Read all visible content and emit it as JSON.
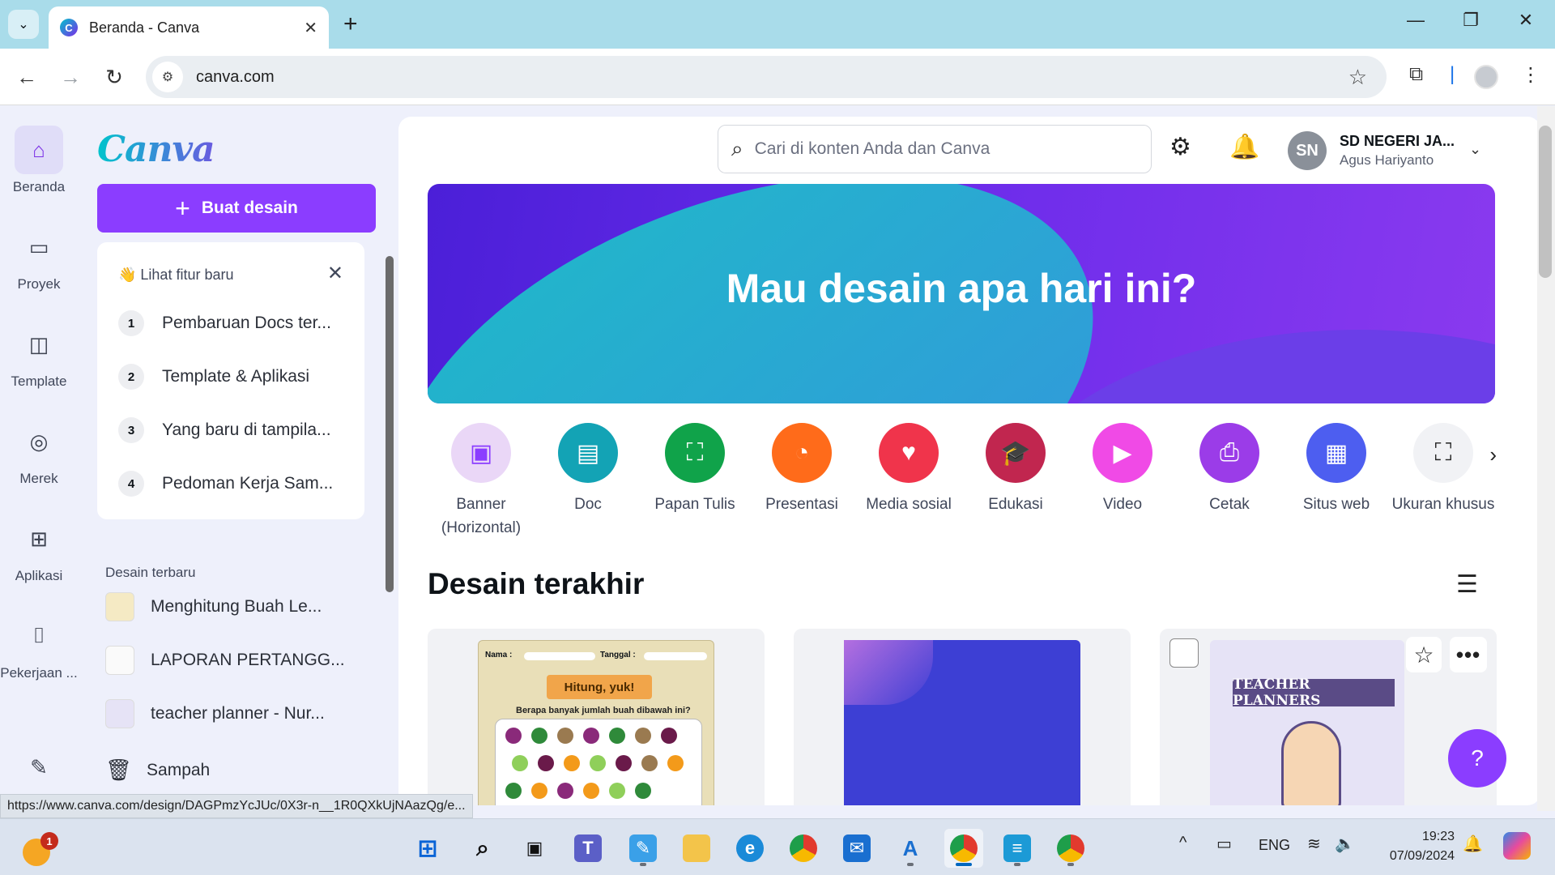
{
  "browser": {
    "tab_title": "Beranda - Canva",
    "tab_favicon": "C",
    "url": "canva.com",
    "status_url": "https://www.canva.com/design/DAGPmzYcJUc/0X3r-n__1R0QXkUjNAazQg/e..."
  },
  "rail": {
    "items": [
      {
        "label": "Beranda",
        "icon": "home-icon"
      },
      {
        "label": "Proyek",
        "icon": "folder-icon"
      },
      {
        "label": "Template",
        "icon": "template-icon"
      },
      {
        "label": "Merek",
        "icon": "brand-icon"
      },
      {
        "label": "Aplikasi",
        "icon": "apps-icon"
      },
      {
        "label": "Pekerjaan ...",
        "icon": "inbox-icon"
      }
    ]
  },
  "panel": {
    "logo": "Canva",
    "create_label": "Buat desain",
    "whatsnew_title": "👋 Lihat fitur baru",
    "whatsnew_items": [
      {
        "num": "1",
        "text": "Pembaruan Docs ter..."
      },
      {
        "num": "2",
        "text": "Template & Aplikasi"
      },
      {
        "num": "3",
        "text": "Yang baru di tampila..."
      },
      {
        "num": "4",
        "text": "Pedoman Kerja Sam..."
      }
    ],
    "recent_title": "Desain terbaru",
    "recent_items": [
      {
        "text": "Menghitung Buah Le..."
      },
      {
        "text": "LAPORAN PERTANGG..."
      },
      {
        "text": "teacher planner - Nur..."
      }
    ],
    "trash_label": "Sampah"
  },
  "header": {
    "search_placeholder": "Cari di konten Anda dan Canva",
    "avatar_initials": "SN",
    "account_name": "SD NEGERI JA...",
    "account_user": "Agus Hariyanto"
  },
  "hero": {
    "title": "Mau desain apa hari ini?"
  },
  "categories": [
    {
      "label": "Banner (Horizontal)",
      "color": "#ead7f7",
      "icon": "banner-icon"
    },
    {
      "label": "Doc",
      "color": "#13a3b5",
      "icon": "doc-icon"
    },
    {
      "label": "Papan Tulis",
      "color": "#10a34a",
      "icon": "whiteboard-icon"
    },
    {
      "label": "Presentasi",
      "color": "#ff6b1a",
      "icon": "presentation-icon"
    },
    {
      "label": "Media sosial",
      "color": "#f0344b",
      "icon": "heart-icon"
    },
    {
      "label": "Edukasi",
      "color": "#c1264f",
      "icon": "graduation-cap-icon"
    },
    {
      "label": "Video",
      "color": "#f04ae6",
      "icon": "video-icon"
    },
    {
      "label": "Cetak",
      "color": "#9b3ce8",
      "icon": "printer-icon"
    },
    {
      "label": "Situs web",
      "color": "#4d5ef0",
      "icon": "website-icon"
    },
    {
      "label": "Ukuran khusus",
      "color": "#f1f2f5",
      "icon": "custom-size-icon"
    }
  ],
  "recent_designs": {
    "title": "Desain terakhir",
    "worksheet_name_label": "Nama :",
    "worksheet_date_label": "Tanggal :",
    "worksheet_title": "Hitung, yuk!",
    "worksheet_question": "Berapa banyak jumlah buah dibawah ini?",
    "planner_title": "TEACHER PLANNERS"
  },
  "help_label": "?",
  "taskbar": {
    "weather_badge": "1",
    "language": "ENG",
    "time": "19:23",
    "date": "07/09/2024"
  }
}
